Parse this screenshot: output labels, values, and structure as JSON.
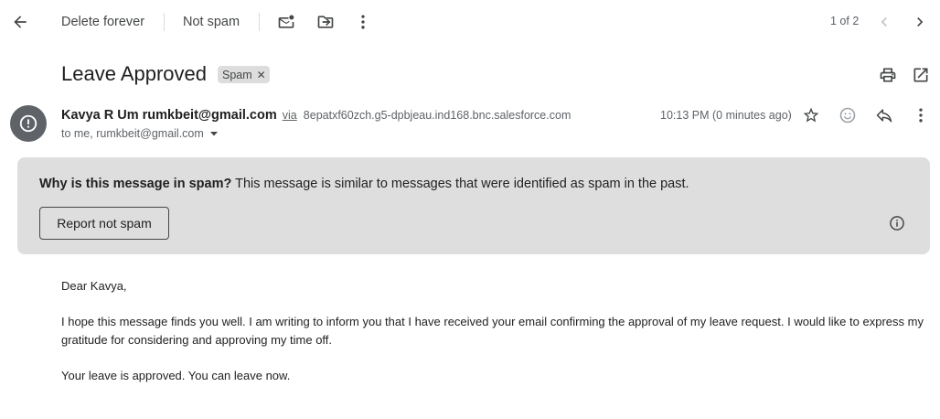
{
  "toolbar": {
    "back_icon": "arrow-left-icon",
    "delete_forever": "Delete forever",
    "not_spam": "Not spam",
    "mark_unread_icon": "mark-unread-icon",
    "move_to_icon": "folder-move-icon",
    "more_icon": "more-vert-icon",
    "pager": "1 of 2",
    "prev_icon": "chevron-left-icon",
    "next_icon": "chevron-right-icon"
  },
  "header": {
    "subject": "Leave Approved",
    "label": "Spam",
    "print_icon": "print-icon",
    "open_new_window_icon": "open-in-new-icon"
  },
  "message": {
    "sender_name": "Kavya R Um",
    "sender_email": "rumkbeit@gmail.com",
    "via_label": "via",
    "via_domain": "8epatxf60zch.g5-dpbjeau.ind168.bnc.salesforce.com",
    "to_line": "to me, rumkbeit@gmail.com",
    "timestamp": "10:13 PM (0 minutes ago)",
    "avatar_icon": "alert-circle-icon"
  },
  "spam_notice": {
    "question": "Why is this message in spam?",
    "explanation": "This message is similar to messages that were identified as spam in the past.",
    "report_button": "Report not spam",
    "info_icon": "info-icon"
  },
  "body": {
    "greeting": "Dear Kavya,",
    "paragraph1": "I hope this message finds you well. I am writing to inform you that I have received your email confirming the approval of my leave request. I would like to express my gratitude for considering and approving my time off.",
    "paragraph2": "Your leave is approved. You can leave now."
  },
  "colors": {
    "icon": "#444746",
    "secondary_text": "#5f6368",
    "spam_box_bg": "#dedede",
    "avatar_bg": "#5f6368"
  }
}
